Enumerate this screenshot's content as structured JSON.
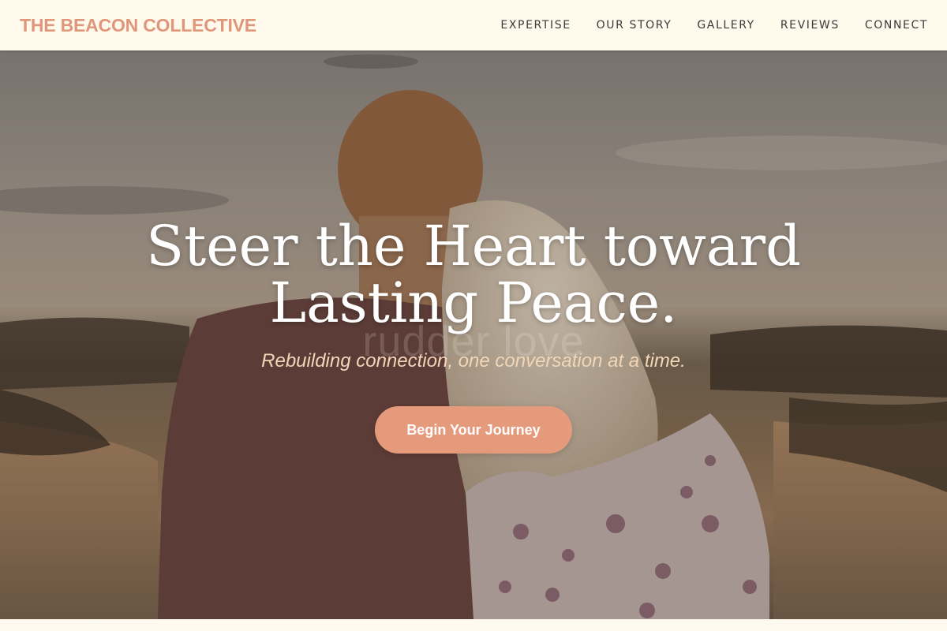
{
  "header": {
    "brand": "THE BEACON COLLECTIVE",
    "nav": [
      {
        "label": "EXPERTISE"
      },
      {
        "label": "OUR STORY"
      },
      {
        "label": "GALLERY"
      },
      {
        "label": "REVIEWS"
      },
      {
        "label": "CONNECT"
      }
    ]
  },
  "hero": {
    "headline_line1": "Steer the Heart toward",
    "headline_line2": "Lasting Peace.",
    "ghost_text": "rudder love",
    "subline": "Rebuilding connection, one conversation at a time.",
    "cta_label": "Begin Your Journey",
    "image_description": "couple-at-lakeside-sunset"
  },
  "colors": {
    "brand": "#e0967a",
    "cta": "#e69a7c",
    "header_bg": "#fffaec",
    "subline": "#f3d6b8"
  }
}
